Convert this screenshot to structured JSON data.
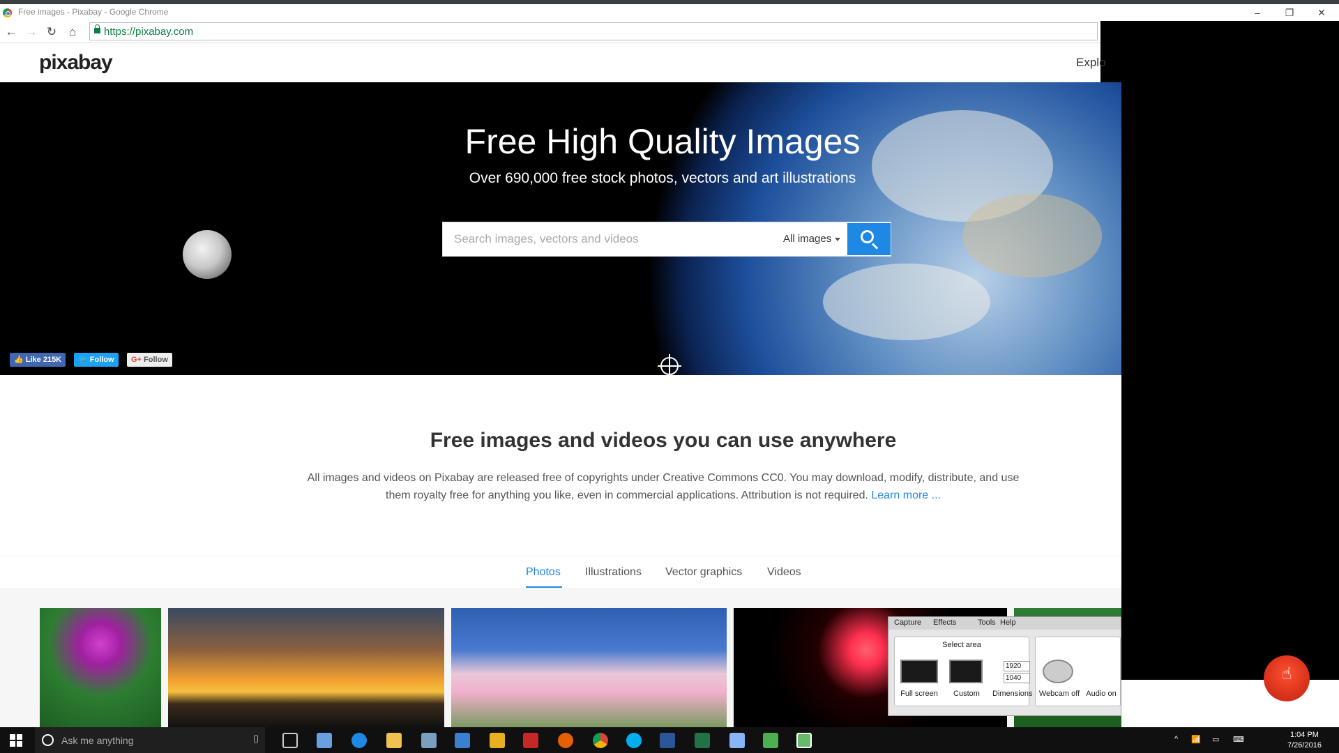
{
  "browser": {
    "tab_title": "Free images - Pixabay - Google Chrome",
    "url": "https://pixabay.com",
    "window_controls": [
      "–",
      "❐",
      "✕"
    ]
  },
  "site": {
    "logo": "pixabay",
    "nav_explore": "Explo"
  },
  "hero": {
    "title": "Free High Quality Images",
    "subtitle": "Over 690,000 free stock photos, vectors and art illustrations",
    "search_placeholder": "Search images, vectors and videos",
    "search_filter": "All images",
    "social": {
      "like": "Like 215K",
      "twitter": "Follow",
      "gplus": "Follow"
    }
  },
  "intro": {
    "title": "Free images and videos you can use anywhere",
    "text": "All images and videos on Pixabay are released free of copyrights under Creative Commons CC0. You may download, modify, distribute, and use them royalty free for anything you like, even in commercial applications. Attribution is not required.",
    "learn_more": "Learn more ..."
  },
  "tabs": [
    {
      "label": "Photos",
      "active": true
    },
    {
      "label": "Illustrations",
      "active": false
    },
    {
      "label": "Vector graphics",
      "active": false
    },
    {
      "label": "Videos",
      "active": false
    }
  ],
  "recorder": {
    "menu": [
      "Capture",
      "Effects",
      "Tools",
      "Help"
    ],
    "select_area": "Select area",
    "full_screen": "Full screen",
    "custom": "Custom",
    "dimensions": "Dimensions",
    "width": "1920",
    "height": "1040",
    "webcam": "Webcam off",
    "audio": "Audio on"
  },
  "taskbar": {
    "search_placeholder": "Ask me anything",
    "time": "1:04 PM",
    "date": "7/26/2016"
  },
  "colors": {
    "accent": "#1e88e5",
    "url_green": "#0b8043",
    "taskbar": "#101010"
  }
}
